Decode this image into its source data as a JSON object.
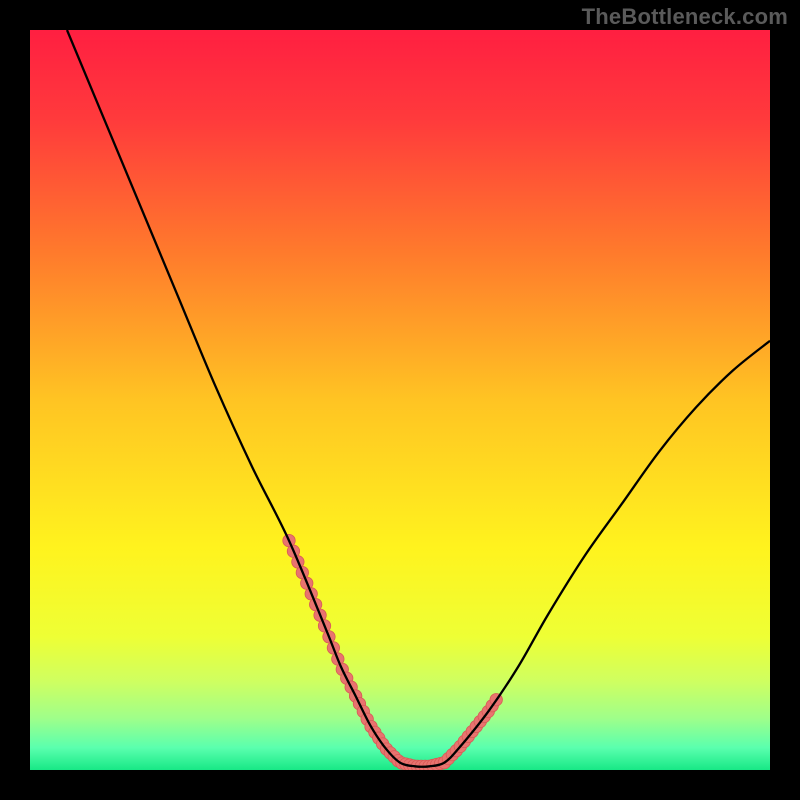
{
  "watermark": "TheBottleneck.com",
  "chart_data": {
    "type": "line",
    "title": "",
    "xlabel": "",
    "ylabel": "",
    "xlim": [
      0,
      100
    ],
    "ylim": [
      0,
      100
    ],
    "grid": false,
    "series": [
      {
        "name": "bottleneck-curve",
        "x": [
          5,
          10,
          15,
          20,
          25,
          30,
          35,
          40,
          42,
          44,
          46,
          48,
          50,
          52,
          54,
          56,
          58,
          62,
          66,
          70,
          75,
          80,
          85,
          90,
          95,
          100
        ],
        "y": [
          100,
          88,
          76,
          64,
          52,
          41,
          31,
          19,
          14,
          10,
          6,
          3,
          1,
          0.5,
          0.5,
          1,
          3,
          8,
          14,
          21,
          29,
          36,
          43,
          49,
          54,
          58
        ]
      }
    ],
    "marker_ranges": {
      "left": {
        "x_from": 35,
        "x_to": 44
      },
      "base": {
        "x_from": 44,
        "x_to": 56
      },
      "right": {
        "x_from": 56,
        "x_to": 63
      }
    },
    "gradient_stops": [
      {
        "offset": 0.0,
        "color": "#ff1f41"
      },
      {
        "offset": 0.12,
        "color": "#ff3a3c"
      },
      {
        "offset": 0.3,
        "color": "#ff7a2c"
      },
      {
        "offset": 0.5,
        "color": "#ffc423"
      },
      {
        "offset": 0.7,
        "color": "#fff31e"
      },
      {
        "offset": 0.82,
        "color": "#eeff35"
      },
      {
        "offset": 0.88,
        "color": "#cfff60"
      },
      {
        "offset": 0.93,
        "color": "#9fff8a"
      },
      {
        "offset": 0.97,
        "color": "#5affae"
      },
      {
        "offset": 1.0,
        "color": "#17e886"
      }
    ],
    "colors": {
      "marker_fill": "#e8736f",
      "marker_stroke": "#d85a56",
      "curve": "#000000",
      "frame": "#000000"
    }
  }
}
